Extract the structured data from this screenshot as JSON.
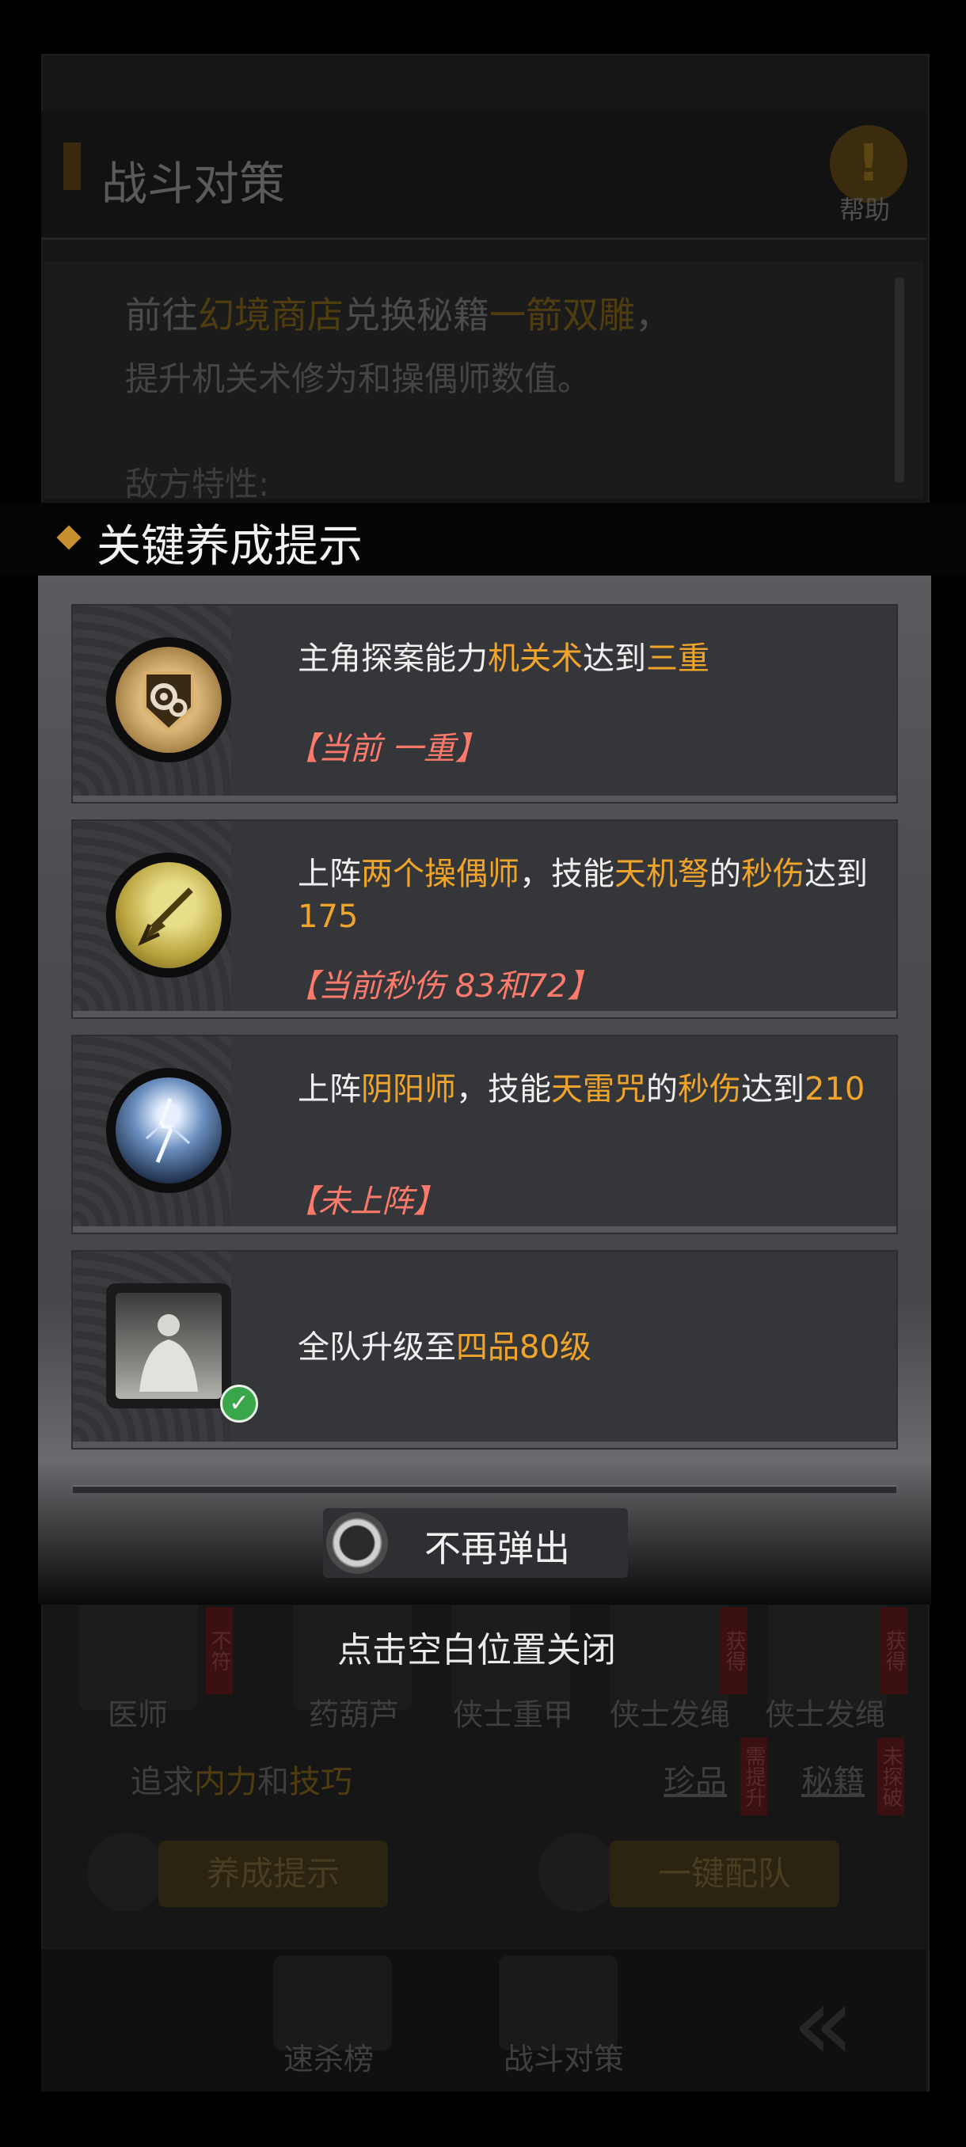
{
  "background": {
    "title": "战斗对策",
    "help_label": "帮助",
    "help_icon_glyph": "!",
    "desc": {
      "prefix": "前往",
      "shop": "幻境商店",
      "mid": "兑换秘籍",
      "book": "一箭双雕",
      "suffix": "，",
      "line2": "提升机关术修为和操偶师数值。",
      "line3": "敌方特性:"
    },
    "units": [
      {
        "label": "医师",
        "badge": "不符"
      },
      {
        "label": "药葫芦",
        "badge": ""
      },
      {
        "label": "侠士重甲",
        "badge": ""
      },
      {
        "label": "侠士发绳",
        "badge": "获得"
      },
      {
        "label": "侠士发绳",
        "badge": "获得"
      }
    ],
    "pursue": {
      "prefix": "追求",
      "a": "内力",
      "and": "和",
      "b": "技巧"
    },
    "links": {
      "treasure": "珍品",
      "treasure_badge": "需提升",
      "secret": "秘籍",
      "secret_badge": "未探破"
    },
    "buttons": {
      "cultivate": "养成提示",
      "auto_team": "一键配队"
    },
    "nav": {
      "tab1": "速杀榜",
      "tab2": "战斗对策",
      "back_glyph": "«"
    }
  },
  "modal": {
    "title": "关键养成提示",
    "tips": [
      {
        "icon": "gear-shield-icon",
        "parts": [
          {
            "t": "主角探案能力"
          },
          {
            "t": "机关术",
            "hl": true
          },
          {
            "t": "达到"
          },
          {
            "t": "三重",
            "hl": true
          }
        ],
        "status": "【当前 一重】"
      },
      {
        "icon": "arrow-skill-icon",
        "parts": [
          {
            "t": "上阵"
          },
          {
            "t": "两个操偶师",
            "hl": true
          },
          {
            "t": "，技能"
          },
          {
            "t": "天机弩",
            "hl": true
          },
          {
            "t": "的"
          },
          {
            "t": "秒伤",
            "hl": true
          },
          {
            "t": "达到"
          },
          {
            "t": "175",
            "hl": true
          }
        ],
        "status": "【当前秒伤 83和72】"
      },
      {
        "icon": "lightning-skill-icon",
        "parts": [
          {
            "t": "上阵"
          },
          {
            "t": "阴阳师",
            "hl": true
          },
          {
            "t": "，技能"
          },
          {
            "t": "天雷咒",
            "hl": true
          },
          {
            "t": "的"
          },
          {
            "t": "秒伤",
            "hl": true
          },
          {
            "t": "达到"
          },
          {
            "t": "210",
            "hl": true
          }
        ],
        "status": "【未上阵】"
      },
      {
        "icon": "character-portrait-icon",
        "parts": [
          {
            "t": "全队升级至"
          },
          {
            "t": "四品80级",
            "hl": true
          }
        ],
        "status": "",
        "completed": true
      }
    ],
    "dont_show_label": "不再弹出",
    "close_hint": "点击空白位置关闭"
  },
  "colors": {
    "highlight": "#f0a52a",
    "status": "#ff7a6b",
    "check": "#3aa64a"
  }
}
